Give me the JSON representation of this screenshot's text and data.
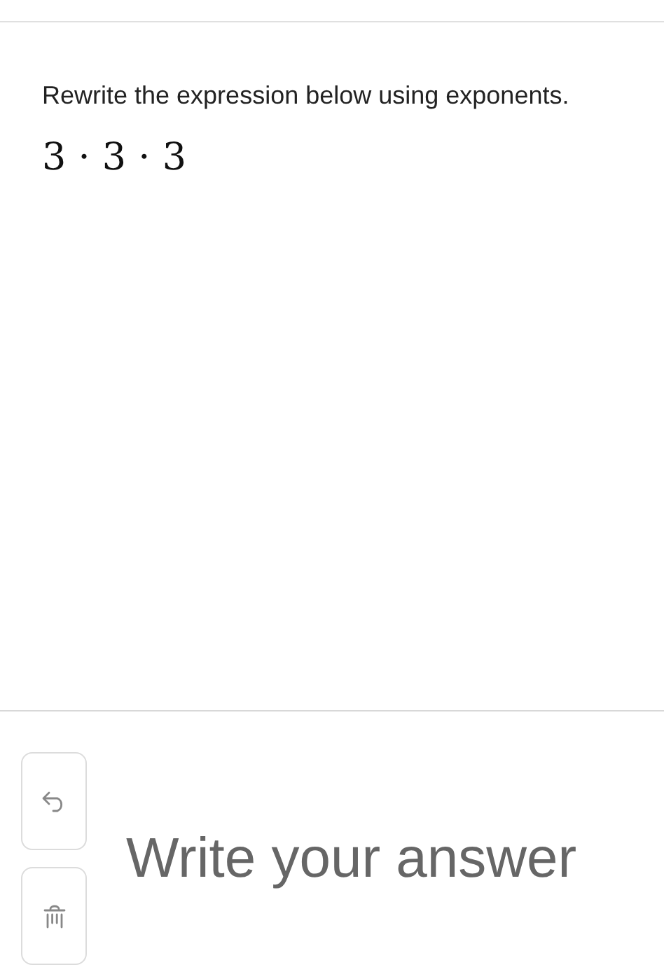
{
  "question": {
    "prompt": "Rewrite the expression below using exponents.",
    "expression": "3 · 3 · 3"
  },
  "answer": {
    "placeholder": "Write your answer"
  },
  "tools": [
    {
      "kind": "undo"
    },
    {
      "kind": "clear"
    }
  ]
}
